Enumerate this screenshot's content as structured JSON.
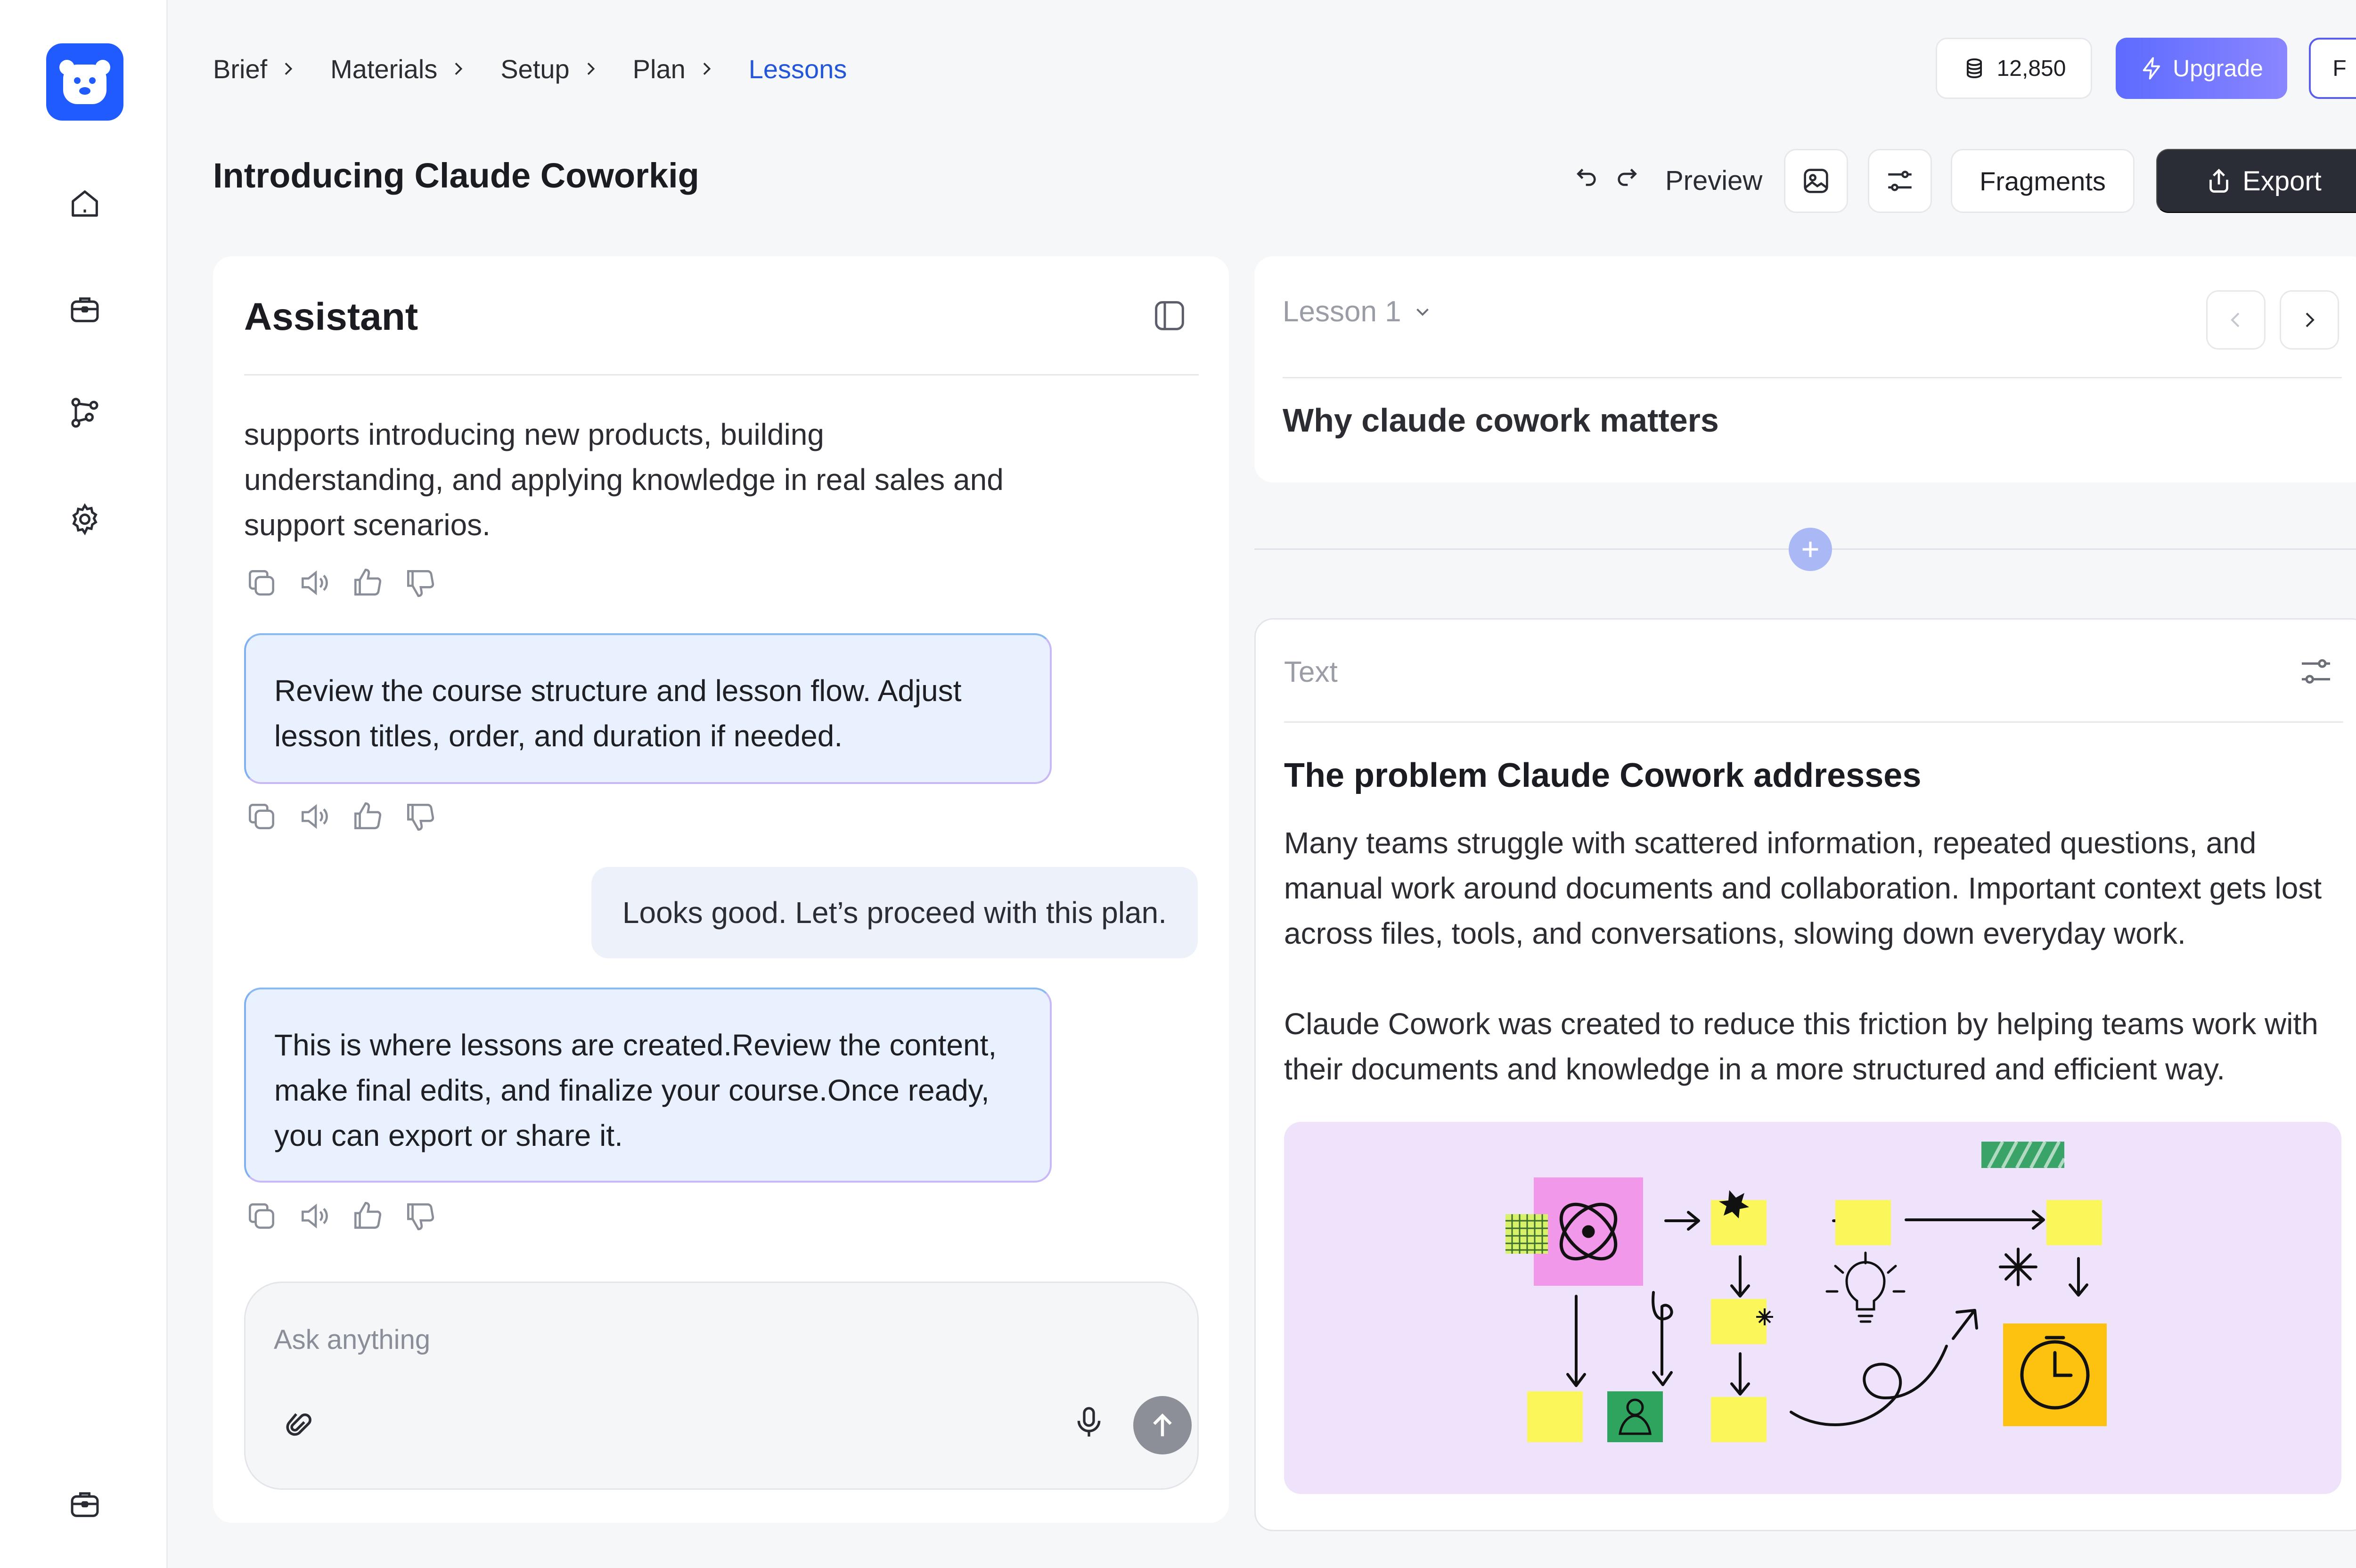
{
  "breadcrumb": [
    "Brief",
    "Materials",
    "Setup",
    "Plan",
    "Lessons"
  ],
  "credits": "12,850",
  "upgrade_label": "Upgrade",
  "avatar_initial": "F",
  "page_title": "Introducing Claude Coworkig",
  "toolbar": {
    "preview_label": "Preview",
    "fragments_label": "Fragments",
    "export_label": "Export"
  },
  "assistant": {
    "title": "Assistant",
    "message_1": "supports introducing new products, building understanding, and applying knowledge in real sales and support scenarios.",
    "message_2": "Review the course structure and lesson flow. Adjust lesson titles, order, and duration if needed.",
    "user_message": "Looks good. Let’s proceed with this plan.",
    "message_3": "This is where lessons are created.Review the content, make final edits, and finalize your course.Once ready, you can export or share it.",
    "composer_placeholder": "Ask anything"
  },
  "lesson": {
    "selector_label": "Lesson 1",
    "title": "Why claude cowork matters"
  },
  "text_block": {
    "label": "Text",
    "heading": "The problem Claude Cowork addresses",
    "paragraph_1": "Many teams struggle with scattered information, repeated questions, and manual work around documents and collaboration. Important context gets lost across files, tools, and conversations, slowing down everyday work.",
    "paragraph_2": "Claude Cowork was created to reduce this friction by helping teams work with their documents and knowledge in a more structured and efficient way."
  },
  "colors": {
    "brand": "#1f5bff",
    "upgrade_start": "#5d6bff",
    "export_bg": "#2a2c36",
    "bubble_bg": "#e8f1fd",
    "illustration_bg": "#efe3fb"
  }
}
